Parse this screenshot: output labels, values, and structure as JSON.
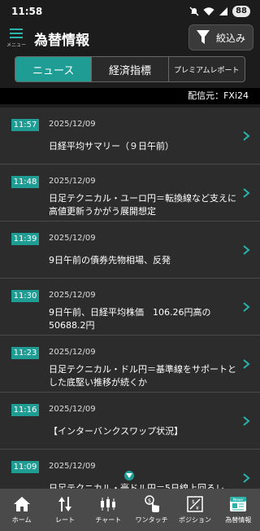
{
  "status": {
    "time": "11:58",
    "battery": "88"
  },
  "header": {
    "menu_label": "メニュー",
    "title": "為替情報",
    "filter_label": "絞込み"
  },
  "tabs": [
    {
      "label": "ニュース",
      "active": true
    },
    {
      "label": "経済指標",
      "active": false
    },
    {
      "label": "プレミアムレポート",
      "active": false
    }
  ],
  "source": "配信元：FXi24",
  "news": [
    {
      "time": "11:57",
      "date": "2025/12/09",
      "title": "日経平均サマリー（９日午前）"
    },
    {
      "time": "11:48",
      "date": "2025/12/09",
      "title": "日足テクニカル・ユーロ円＝転換線など支えに高値更新うかがう展開想定"
    },
    {
      "time": "11:39",
      "date": "2025/12/09",
      "title": "9日午前の債券先物相場、反発"
    },
    {
      "time": "11:30",
      "date": "2025/12/09",
      "title": "9日午前、日経平均株価　106.26円高の50688.2円"
    },
    {
      "time": "11:23",
      "date": "2025/12/09",
      "title": "日足テクニカル・ドル円＝基準線をサポートとした底堅い推移が続くか"
    },
    {
      "time": "11:16",
      "date": "2025/12/09",
      "title": "【インターバンクスワップ状況】"
    },
    {
      "time": "11:09",
      "date": "2025/12/09",
      "title": "日足テクニカル・豪ドル円＝5日線上回るレ"
    }
  ],
  "nav": [
    {
      "label": "ホーム",
      "icon": "home-icon"
    },
    {
      "label": "レート",
      "icon": "rate-icon"
    },
    {
      "label": "チャート",
      "icon": "chart-icon"
    },
    {
      "label": "ワンタッチ",
      "icon": "one-touch-icon"
    },
    {
      "label": "ポジション",
      "icon": "position-icon"
    },
    {
      "label": "為替情報",
      "icon": "news-icon",
      "badge": "News",
      "active": true
    }
  ],
  "colors": {
    "accent": "#1f9c94",
    "background": "#1c1c1c",
    "nav": "#4a4a4a"
  }
}
